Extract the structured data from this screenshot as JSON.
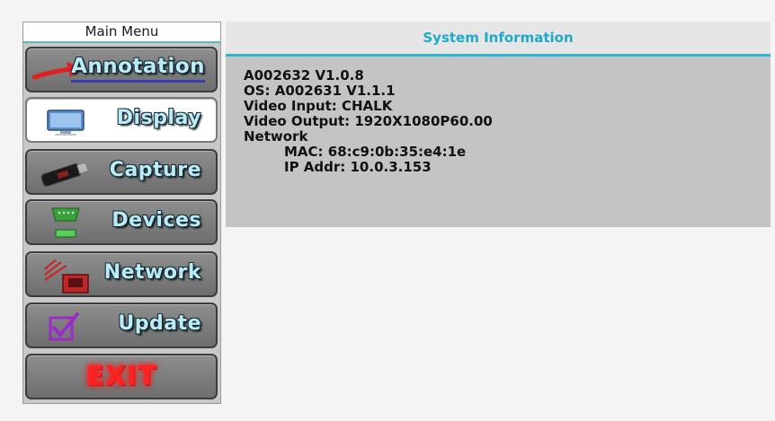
{
  "sidebar": {
    "title": "Main Menu",
    "items": [
      {
        "id": "annotation",
        "label": "Annotation",
        "icon": "red-arrow-icon"
      },
      {
        "id": "display",
        "label": "Display",
        "icon": "monitor-icon",
        "active": true
      },
      {
        "id": "capture",
        "label": "Capture",
        "icon": "usb-drive-icon"
      },
      {
        "id": "devices",
        "label": "Devices",
        "icon": "serial-port-icon"
      },
      {
        "id": "network",
        "label": "Network",
        "icon": "network-port-icon"
      },
      {
        "id": "update",
        "label": "Update",
        "icon": "checkbox-icon"
      },
      {
        "id": "exit",
        "label": "EXIT",
        "icon": ""
      }
    ]
  },
  "main": {
    "title": "System Information",
    "lines": [
      "A002632 V1.0.8",
      "OS: A002631 V1.1.1",
      "Video Input: CHALK",
      "Video Output: 1920X1080P60.00",
      "Network",
      "MAC: 68:c9:0b:35:e4:1e",
      "IP Addr: 10.0.3.153"
    ]
  },
  "colors": {
    "accent": "#2ab7d6",
    "button_text": "#b9ecf7",
    "exit_text": "#ff2222",
    "panel_bg": "#c4c4c4"
  }
}
